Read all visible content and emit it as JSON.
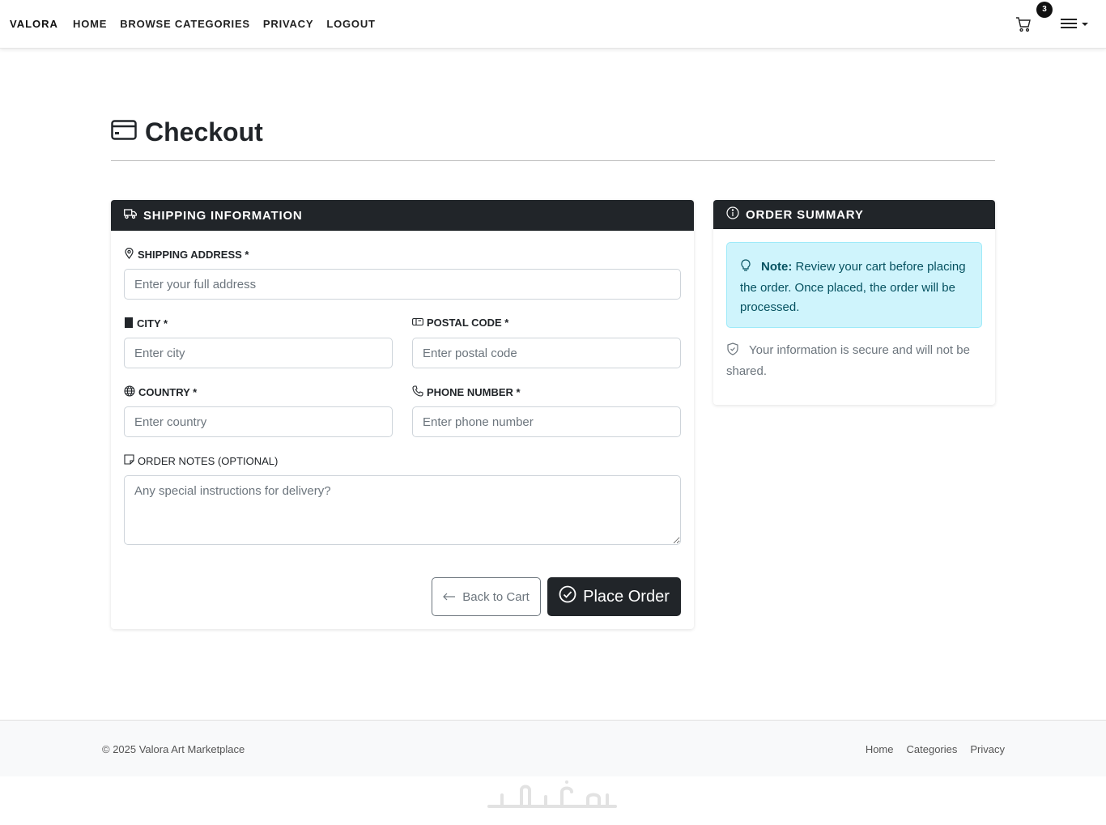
{
  "navbar": {
    "brand": "VALORA",
    "links": [
      "HOME",
      "BROWSE CATEGORIES",
      "PRIVACY",
      "LOGOUT"
    ],
    "cart_count": "3"
  },
  "page": {
    "title": "Checkout"
  },
  "shipping": {
    "header": "SHIPPING INFORMATION",
    "address_label": "SHIPPING ADDRESS *",
    "address_placeholder": "Enter your full address",
    "city_label": "CITY *",
    "city_placeholder": "Enter city",
    "postal_label": "POSTAL CODE *",
    "postal_placeholder": "Enter postal code",
    "country_label": "COUNTRY *",
    "country_placeholder": "Enter country",
    "phone_label": "PHONE NUMBER *",
    "phone_placeholder": "Enter phone number",
    "notes_label": "ORDER NOTES (OPTIONAL)",
    "notes_placeholder": "Any special instructions for delivery?",
    "back_label": "Back to Cart",
    "place_label": "Place Order"
  },
  "summary": {
    "header": "ORDER SUMMARY",
    "note_bold": "Note:",
    "note_text": " Review your cart before placing the order. Once placed, the order will be processed.",
    "secure_text": "Your information is secure and will not be shared."
  },
  "footer": {
    "copyright": "© 2025 Valora Art Marketplace",
    "links": [
      "Home",
      "Categories",
      "Privacy"
    ]
  },
  "colors": {
    "dark": "#212529",
    "info_bg": "#cff4fc",
    "info_text": "#055160",
    "muted": "#6c757d"
  }
}
